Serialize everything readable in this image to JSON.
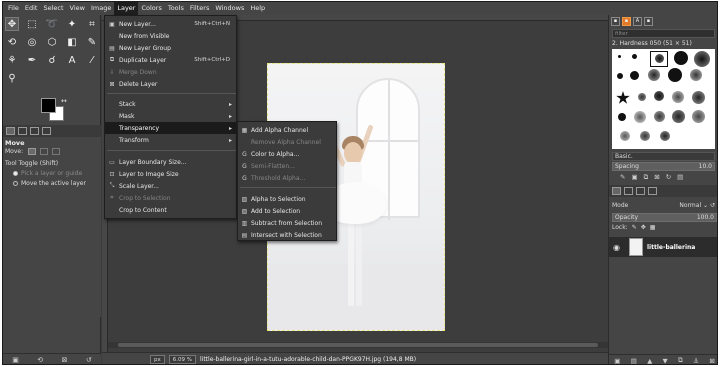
{
  "menubar": [
    "File",
    "Edit",
    "Select",
    "View",
    "Image",
    "Layer",
    "Colors",
    "Tools",
    "Filters",
    "Windows",
    "Help"
  ],
  "layer_menu": {
    "new_layer": "New Layer...",
    "new_layer_sc": "Shift+Ctrl+N",
    "new_from_visible": "New from Visible",
    "new_layer_group": "New Layer Group",
    "duplicate_layer": "Duplicate Layer",
    "duplicate_layer_sc": "Shift+Ctrl+D",
    "merge_down": "Merge Down",
    "delete_layer": "Delete Layer",
    "stack": "Stack",
    "mask": "Mask",
    "transparency": "Transparency",
    "transform": "Transform",
    "layer_boundary_size": "Layer Boundary Size...",
    "layer_to_image_size": "Layer to Image Size",
    "scale_layer": "Scale Layer...",
    "crop_to_selection": "Crop to Selection",
    "crop_to_content": "Crop to Content"
  },
  "transparency_menu": {
    "add_alpha": "Add Alpha Channel",
    "remove_alpha": "Remove Alpha Channel",
    "color_to_alpha": "Color to Alpha...",
    "semi_flatten": "Semi-Flatten...",
    "threshold_alpha": "Threshold Alpha...",
    "alpha_to_selection": "Alpha to Selection",
    "add_to_selection": "Add to Selection",
    "subtract_from_selection": "Subtract from Selection",
    "intersect_with_selection": "Intersect with Selection"
  },
  "tool_options": {
    "title": "Move",
    "move_label": "Move:",
    "tool_toggle": "Tool Toggle  (Shift)",
    "pick_layer": "Pick a layer or guide",
    "move_active": "Move the active layer"
  },
  "status": {
    "unit": "px",
    "zoom": "6.09 %",
    "filename": "little-ballerina-girl-in-a-tutu-adorable-child-dan-PPGK97H.jpg (194,8 MB)"
  },
  "brushes": {
    "filter_placeholder": "filter",
    "name": "2. Hardness 050 (51 × 51)",
    "tag": "Basic.",
    "spacing_label": "Spacing",
    "spacing_value": "10.0"
  },
  "layers": {
    "mode_label": "Mode",
    "mode_value": "Normal",
    "opacity_label": "Opacity",
    "opacity_value": "100.0",
    "lock_label": "Lock:",
    "layer_name": "little-ballerina"
  }
}
